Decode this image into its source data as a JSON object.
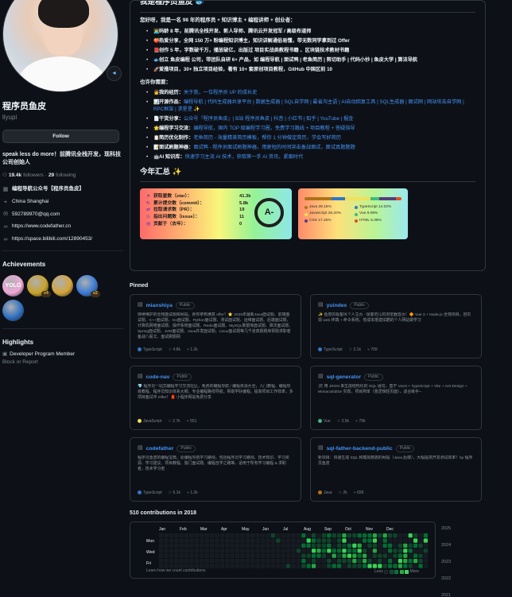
{
  "profile": {
    "display_name": "程序员鱼皮",
    "username": "liyupi",
    "follow_label": "Follow",
    "bio": "speak less do more！前腾讯全栈开发，现科技公司创始人",
    "followers_count": "19.4k",
    "followers_label": "followers",
    "following_count": "29",
    "following_label": "following",
    "details": [
      {
        "icon": "organization-icon",
        "text": "编程导航公众号【程序员鱼皮】",
        "bold": true,
        "link": false
      },
      {
        "icon": "location-icon",
        "text": "China Shanghai",
        "bold": false,
        "link": false
      },
      {
        "icon": "mail-icon",
        "text": "592789970@qq.com",
        "bold": false,
        "link": false
      },
      {
        "icon": "link-icon",
        "text": "https://www.codefather.cn",
        "bold": false,
        "link": false
      },
      {
        "icon": "link-icon",
        "text": "https://space.bilibili.com/12890453/",
        "bold": false,
        "link": false
      }
    ],
    "achievements_title": "Achievements",
    "achievements": [
      {
        "name": "yolo",
        "label": "YOLO",
        "count": "",
        "color": "#f0a8d8"
      },
      {
        "name": "pair-extraordinaire",
        "label": "",
        "count": "x4",
        "color": "#c9a227"
      },
      {
        "name": "quickdraw",
        "label": "",
        "count": "",
        "color": "#d6a53a"
      },
      {
        "name": "pull-shark",
        "label": "",
        "count": "x2",
        "color": "#3a7bd5"
      },
      {
        "name": "arctic-code-vault",
        "label": "",
        "count": "",
        "color": "#2f6fc0"
      }
    ],
    "highlights_title": "Highlights",
    "highlight_item": "Developer Program Member",
    "block_report": "Block or Report"
  },
  "readme": {
    "title": "我是程序员鱼皮 🐟",
    "intro": "您好呀，我是一名 98 年的程序员 + 知识博主 + 编程讲师 + 创业者：",
    "bullets": [
      {
        "emo": "👨‍💻",
        "text": "码龄 8 年，前腾讯全栈开发、新人导师、腾讯云开发冠军 / 高级布道师"
      },
      {
        "emo": "🍑",
        "text": "热爱分享，全网 150 万+ 粉编程知识博主，知识讲解通俗易懂，带无数同学拿到过 Offer"
      },
      {
        "emo": "📕",
        "text": "创作 5 年，字数破千万，播放破亿，出版过 项目实战类教程书籍 、区块链技术教材书籍"
      },
      {
        "emo": "🐟",
        "text": "创立 鱼皮编程 公司，带团队自研 6+ 产品，如 编程导航 | 面试鸭 | 老鱼简历 | 剪切助手 | 代码小抄 | 鱼皮大学 | 算法导航"
      },
      {
        "emo": "🚀",
        "text": "爱撸项目，30+ 独立项目经验，著有 10+ 套原创项目教程，GitHub 中国区前 10"
      }
    ],
    "subhead": "也许你需要：",
    "needs": [
      {
        "emo": "👩",
        "label": "我的经历：",
        "text": "关于我，一位程序员 UP 的成长史"
      },
      {
        "emo": "📊",
        "label": "开源作品：",
        "text": "编程导航 | 代码生成器共享平台 | 数据生成器 | SQL自学网 | 最省沟主语 | AI自动回复工具 | SQL生成器 | 面试网 | 网站攻击自学网 | RPC框架 | 求星星 ✨"
      },
      {
        "emo": "📄",
        "label": "干货分享：",
        "text": "公众号『程序员鱼皮』| B站 程序员鱼皮 | 抖音 | 小红书 | 知乎 | YouTube | 掘金"
      },
      {
        "emo": "🌟",
        "label": "编程学习交流：",
        "text": "编程导航，国内 TOP 级编程学习圈，免费学习路线 + 项目教程 + 答疑指导"
      },
      {
        "emo": "📋",
        "label": "简历优化制作：",
        "text": "老鱼简历 - 海量精美简历模板，帮你 1 分钟做定简历，学会写好简历"
      },
      {
        "emo": "📝",
        "label": "面试刷题神器：",
        "text": "面试鸭 - 程序员面试刷题神器，用更短的时间突击备战面试，面试真题题题"
      },
      {
        "emo": "🤖",
        "label": "AI 知识库：",
        "text": "快速学习主流 AI 技术，获取第一手 AI 资讯，紧跟时代"
      }
    ],
    "year_title": "今年汇总 ✨"
  },
  "stats": {
    "rows": [
      {
        "icon": "star-icon",
        "label": "获取星数（star）：",
        "value": "41.3k"
      },
      {
        "icon": "commit-icon",
        "label": "累计提交数（commit）：",
        "value": "5.8k"
      },
      {
        "icon": "pr-icon",
        "label": "拉取请求数（PR）：",
        "value": "19"
      },
      {
        "icon": "issue-icon",
        "label": "指出问题数（issue）：",
        "value": "11"
      },
      {
        "icon": "repo-icon",
        "label": "贡献于（去年）：",
        "value": "0"
      }
    ],
    "grade": "A-"
  },
  "langs": {
    "items": [
      {
        "name": "Java 28.16%",
        "percent": 28.16,
        "color": "#b07219"
      },
      {
        "name": "TypeScript 14.02%",
        "percent": 14.02,
        "color": "#3178c6"
      },
      {
        "name": "JavaScript 26.20%",
        "percent": 26.2,
        "color": "#f1e05a"
      },
      {
        "name": "Vue 9.09%",
        "percent": 9.09,
        "color": "#41b883"
      },
      {
        "name": "CSS 17.15%",
        "percent": 17.15,
        "color": "#563d7c"
      },
      {
        "name": "HTML 5.38%",
        "percent": 5.38,
        "color": "#e34c26"
      }
    ]
  },
  "pinned": {
    "title": "Pinned",
    "repos": [
      {
        "name": "mianshiya",
        "vis": "Public",
        "desc": "持续维护的全栈面试题库网站。帮你拿到满意 offer！⭐ 2025年最新Java面试题、前端面试题、C++面试题、Go面试题、Python面试题、测试面试题、运维面试题、后端面试题、计算机网络面试题、操作系统面试题、Redis面试题、MySQL数据库面试题、算法面试题、Spring面试题、JVM面试题、Java并发面试题、Linux面试题等几千道真题题库帮助求职者备战八股文、面试刷题网",
        "lang": "TypeScript",
        "lang_color": "#3178c6",
        "stars": "4.8k",
        "forks": "1.2k"
      },
      {
        "name": "yuindex",
        "vis": "Public",
        "desc": "✨ 鱼皮的极客风个人主页 - 极客范儿的浏览器首页！🔶 Vue 3 + Node.js 全栈项目，自实现 web 终端 + 命令系统，低成本搭建炫酷的个人网站做学习",
        "lang": "TypeScript",
        "lang_color": "#3178c6",
        "stars": "2.1k",
        "forks": "709"
      },
      {
        "name": "code-nav",
        "vis": "Public",
        "desc": "💎 程序员一站式编程学习交流社区，免费的编程导航 / 编程资源大全，入门教程、编程项目教程、程序员知识体系大纲、专业编程路线导航。帮助学好编程，提高项目工作效率，多项目面试中 Offer！🧧 小程序网站免费分享",
        "lang": "JavaScript",
        "lang_color": "#f1e05a",
        "stars": "2.7k",
        "forks": "551"
      },
      {
        "name": "sql-generator",
        "vis": "Public",
        "desc": "🛠 用 JSON 来生成结构化的 SQL 语句，基于 Vue3 + TypeScript + Vite + Ant Design + MonacoEditor 实现，项目简单（重逻辑轻页面），适合练手~",
        "lang": "Vue",
        "lang_color": "#41b883",
        "stars": "3.5k",
        "forks": "70k"
      },
      {
        "name": "codefather",
        "vis": "Public",
        "desc": "程序员鱼皮的编程宝典，原编程导航学习路线。包括程序员学习路线、技术知识、学习资源、学习建议、项目教程、独门面试题、编程自学之路等。适用于所有学习编程 & 求职者，技术学习者",
        "lang": "TypeScript",
        "lang_color": "#3178c6",
        "stars": "6.1k",
        "forks": "1.2k"
      },
      {
        "name": "sql-father-backend-public",
        "vis": "Public",
        "desc": "新项目：快速生成 SQL 和模拟数据的网站（Java 后端），大幅提高开发测试效率！by 程序员鱼皮",
        "lang": "Java",
        "lang_color": "#b07219",
        "stars": "2k",
        "forks": "699"
      }
    ]
  },
  "contributions": {
    "title": "510 contributions in 2018",
    "months": [
      "Jan",
      "Feb",
      "Mar",
      "Apr",
      "May",
      "Jun",
      "Jul",
      "Aug",
      "Sep",
      "Oct",
      "Nov",
      "Dec"
    ],
    "days": [
      "Mon",
      "Wed",
      "Fri"
    ],
    "learn": "Learn how we count contributions",
    "less": "Less",
    "more": "More",
    "colors": [
      "#161b22",
      "#0e4429",
      "#006d32",
      "#26a641",
      "#39d353"
    ],
    "years": [
      "2025",
      "2024",
      "2023",
      "2022",
      "2021"
    ]
  }
}
